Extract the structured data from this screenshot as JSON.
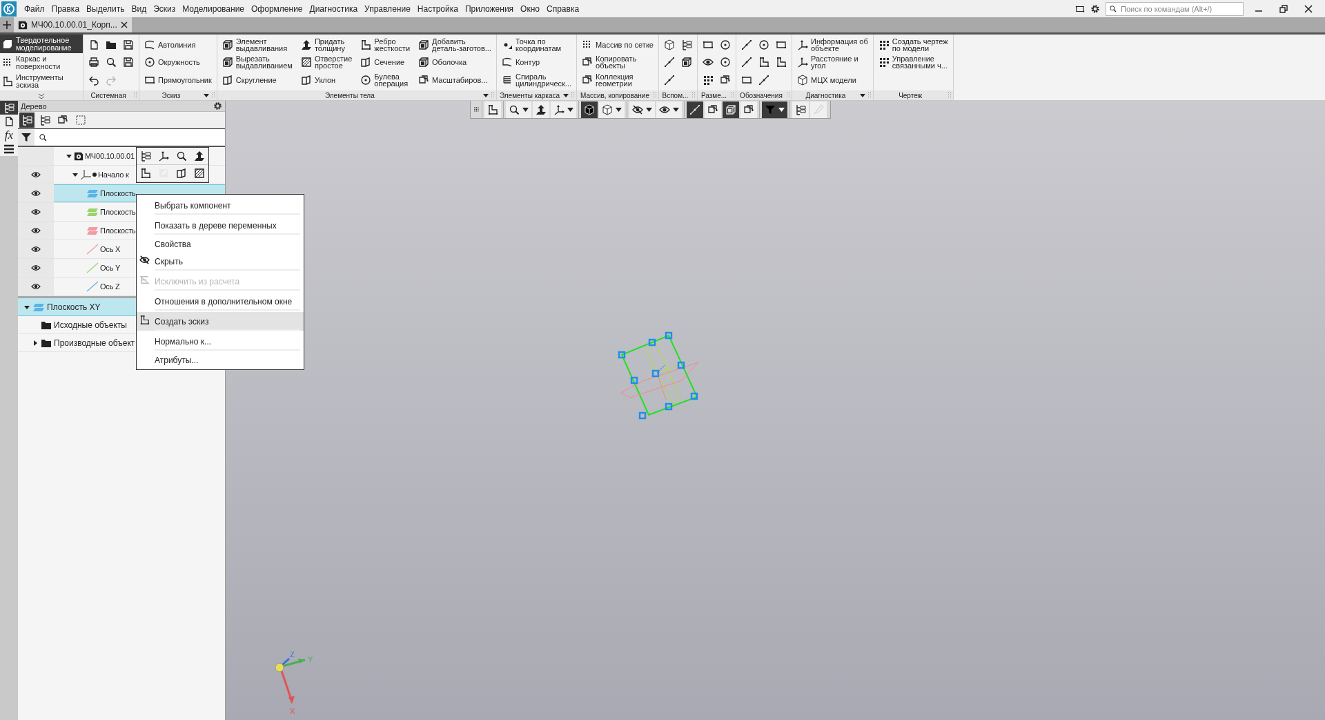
{
  "menu_bar": {
    "items": [
      "Файл",
      "Правка",
      "Выделить",
      "Вид",
      "Эскиз",
      "Моделирование",
      "Оформление",
      "Диагностика",
      "Управление",
      "Настройка",
      "Приложения",
      "Окно",
      "Справка"
    ],
    "search": {
      "placeholder": "Поиск по командам (Alt+/)"
    }
  },
  "document_tabs": [
    {
      "title": "МЧ00.10.00.01_Корп...",
      "selected": true
    }
  ],
  "ribbon": {
    "modes": [
      {
        "label": "Твердотельное\nмоделирование",
        "selected": true
      },
      {
        "label": "Каркас и\nповерхности",
        "selected": false
      },
      {
        "label": "Инструменты\nэскиза",
        "selected": false
      }
    ],
    "groups": [
      {
        "title": "Системная",
        "menu": false,
        "items": [
          {
            "kind": "icon",
            "disabled": false
          },
          {
            "kind": "icon",
            "disabled": false
          },
          {
            "kind": "icon",
            "disabled": false
          },
          {
            "kind": "icon",
            "disabled": false
          },
          {
            "kind": "icon",
            "disabled": false
          },
          {
            "kind": "icon",
            "disabled": true
          },
          {
            "kind": "icon",
            "disabled": false
          },
          {
            "kind": "icon",
            "disabled": false
          }
        ]
      },
      {
        "title": "Эскиз",
        "menu": true,
        "items": [
          {
            "kind": "text",
            "label": "Автолиния"
          },
          {
            "kind": "text",
            "label": "Окружность"
          },
          {
            "kind": "text",
            "label": "Прямоугольник"
          }
        ]
      },
      {
        "title": "Элементы тела",
        "menu": true,
        "items": [
          {
            "kind": "text",
            "label": "Элемент\nвыдавливания"
          },
          {
            "kind": "text",
            "label": "Вырезать\nвыдавливанием"
          },
          {
            "kind": "text",
            "label": "Скругление"
          },
          {
            "kind": "text",
            "label": "Придать\nтолщину"
          },
          {
            "kind": "text",
            "label": "Отверстие\nпростое"
          },
          {
            "kind": "text",
            "label": "Уклон"
          },
          {
            "kind": "text",
            "label": "Ребро\nжесткости"
          },
          {
            "kind": "text",
            "label": "Сечение"
          },
          {
            "kind": "text",
            "label": "Булева\nоперация"
          },
          {
            "kind": "text",
            "label": "Добавить\nдеталь-заготов..."
          },
          {
            "kind": "text",
            "label": "Оболочка"
          },
          {
            "kind": "text",
            "label": "Масштабиров..."
          }
        ]
      },
      {
        "title": "Элементы каркаса",
        "menu": true,
        "items": [
          {
            "kind": "text",
            "label": "Точка по\nкоординатам"
          },
          {
            "kind": "text",
            "label": "Контур"
          },
          {
            "kind": "text",
            "label": "Спираль\nцилиндрическ..."
          }
        ]
      },
      {
        "title": "Массив, копирование",
        "menu": false,
        "items": [
          {
            "kind": "text",
            "label": "Массив по сетке"
          },
          {
            "kind": "text",
            "label": "Копировать\nобъекты"
          },
          {
            "kind": "text",
            "label": "Коллекция\nгеометрии"
          }
        ]
      },
      {
        "title": "Вспом...",
        "menu": false,
        "items": [
          {
            "kind": "icon",
            "disabled": false
          },
          {
            "kind": "icon",
            "disabled": false
          },
          {
            "kind": "icon",
            "disabled": false
          },
          {
            "kind": "icon",
            "disabled": false
          },
          {
            "kind": "icon",
            "disabled": false
          }
        ]
      },
      {
        "title": "Разме...",
        "menu": false,
        "items": [
          {
            "kind": "icon",
            "disabled": false
          },
          {
            "kind": "icon",
            "disabled": false
          },
          {
            "kind": "icon",
            "disabled": false
          },
          {
            "kind": "icon",
            "disabled": false
          },
          {
            "kind": "icon",
            "disabled": false
          },
          {
            "kind": "icon",
            "disabled": false
          }
        ]
      },
      {
        "title": "Обозначения",
        "menu": false,
        "items": [
          {
            "kind": "icon",
            "disabled": false
          },
          {
            "kind": "icon",
            "disabled": false
          },
          {
            "kind": "icon",
            "disabled": false
          },
          {
            "kind": "icon",
            "disabled": false
          },
          {
            "kind": "icon",
            "disabled": false
          },
          {
            "kind": "icon",
            "disabled": false
          },
          {
            "kind": "icon",
            "disabled": false
          },
          {
            "kind": "icon",
            "disabled": false
          }
        ]
      },
      {
        "title": "Диагностика",
        "menu": true,
        "items": [
          {
            "kind": "text",
            "label": "Информация об\nобъекте"
          },
          {
            "kind": "text",
            "label": "Расстояние и\nугол"
          },
          {
            "kind": "text",
            "label": "МЦХ модели"
          }
        ]
      },
      {
        "title": "Чертеж",
        "menu": false,
        "items": [
          {
            "kind": "text",
            "label": "Создать чертеж\nпо модели"
          },
          {
            "kind": "text",
            "label": "Управление\nсвязанными ч..."
          }
        ]
      }
    ]
  },
  "side_strip": [
    {
      "selected": true
    },
    {
      "selected": false
    },
    {
      "selected": false,
      "glyph": "fx"
    },
    {
      "selected": false
    }
  ],
  "tree_panel": {
    "title": "Дерево",
    "view_buttons": [
      {
        "selected": true
      },
      {
        "selected": false
      },
      {
        "selected": false
      },
      {
        "selected": false
      }
    ],
    "tree": [
      {
        "label": "МЧ00.10.00.01",
        "kind": "part",
        "visible": false,
        "expanded": true,
        "selected": false,
        "children": [
          {
            "label": "Начало к",
            "kind": "origin",
            "visible": true,
            "expanded": true,
            "selected": false,
            "children": [
              {
                "label": "Плоскость",
                "kind": "plane",
                "color": "#5ab4e8",
                "visible": true,
                "selected": true
              },
              {
                "label": "Плоскость",
                "kind": "plane",
                "color": "#9ad46a",
                "visible": true,
                "selected": false
              },
              {
                "label": "Плоскость",
                "kind": "plane",
                "color": "#f29aa0",
                "visible": true,
                "selected": false
              },
              {
                "label": "Ось X",
                "kind": "axis",
                "color": "#f29aa0",
                "visible": true,
                "selected": false
              },
              {
                "label": "Ось Y",
                "kind": "axis",
                "color": "#9ad46a",
                "visible": true,
                "selected": false
              },
              {
                "label": "Ось Z",
                "kind": "axis",
                "color": "#5ab4e8",
                "visible": true,
                "selected": false
              }
            ]
          }
        ]
      }
    ],
    "relations": [
      {
        "label": "Плоскость XY",
        "kind": "plane",
        "color": "#5ab4e8",
        "expanded": true,
        "selected": true,
        "children": [
          {
            "label": "Исходные объекты",
            "kind": "folder",
            "selected": false
          },
          {
            "label": "Производные объект",
            "kind": "folder",
            "expanded": false,
            "selected": false
          }
        ]
      }
    ]
  },
  "mini_toolbar": [
    {
      "disabled": false
    },
    {
      "disabled": false
    },
    {
      "disabled": false
    },
    {
      "disabled": false
    },
    {
      "disabled": false
    },
    {
      "disabled": true
    },
    {
      "disabled": false
    },
    {
      "disabled": false
    }
  ],
  "context_menu": [
    {
      "label": "Выбрать компонент",
      "kind": "plain",
      "disabled": false,
      "selected": false,
      "separator_after": true
    },
    {
      "label": "Показать в дереве переменных",
      "kind": "plain",
      "disabled": false,
      "selected": false,
      "separator_after": true
    },
    {
      "label": "Свойства",
      "kind": "plain",
      "disabled": false,
      "selected": false,
      "separator_after": false
    },
    {
      "label": "Скрыть",
      "kind": "hide",
      "disabled": false,
      "selected": false,
      "separator_after": true
    },
    {
      "label": "Исключить из расчета",
      "kind": "exclude",
      "disabled": true,
      "selected": false,
      "separator_after": true
    },
    {
      "label": "Отношения в дополнительном окне",
      "kind": "plain",
      "disabled": false,
      "selected": false,
      "separator_after": true
    },
    {
      "label": "Создать эскиз",
      "kind": "sketch",
      "disabled": false,
      "selected": true,
      "separator_after": true
    },
    {
      "label": "Нормально к...",
      "kind": "plain",
      "disabled": false,
      "selected": false,
      "separator_after": true
    },
    {
      "label": "Атрибуты...",
      "kind": "plain",
      "disabled": false,
      "selected": false,
      "separator_after": false
    }
  ],
  "view_toolbar": [
    [
      {
        "selected": false,
        "dropdown": false,
        "disabled": false
      }
    ],
    [
      {
        "selected": false,
        "dropdown": true,
        "disabled": false
      },
      {
        "selected": false,
        "dropdown": false,
        "disabled": false
      },
      {
        "selected": false,
        "dropdown": true,
        "disabled": false
      }
    ],
    [
      {
        "selected": true,
        "dropdown": false,
        "disabled": false
      },
      {
        "selected": false,
        "dropdown": true,
        "disabled": false
      }
    ],
    [
      {
        "selected": false,
        "dropdown": true,
        "disabled": false
      },
      {
        "selected": false,
        "dropdown": true,
        "disabled": false
      }
    ],
    [
      {
        "selected": true,
        "dropdown": false,
        "disabled": false
      },
      {
        "selected": false,
        "dropdown": false,
        "disabled": false
      },
      {
        "selected": true,
        "dropdown": false,
        "disabled": false
      },
      {
        "selected": false,
        "dropdown": false,
        "disabled": false
      }
    ],
    [
      {
        "selected": true,
        "dropdown": true,
        "disabled": false
      }
    ],
    [
      {
        "selected": false,
        "dropdown": false,
        "disabled": false
      },
      {
        "selected": false,
        "dropdown": false,
        "disabled": true
      }
    ]
  ],
  "triad": {
    "x": "X",
    "y": "Y",
    "z": "Z"
  }
}
